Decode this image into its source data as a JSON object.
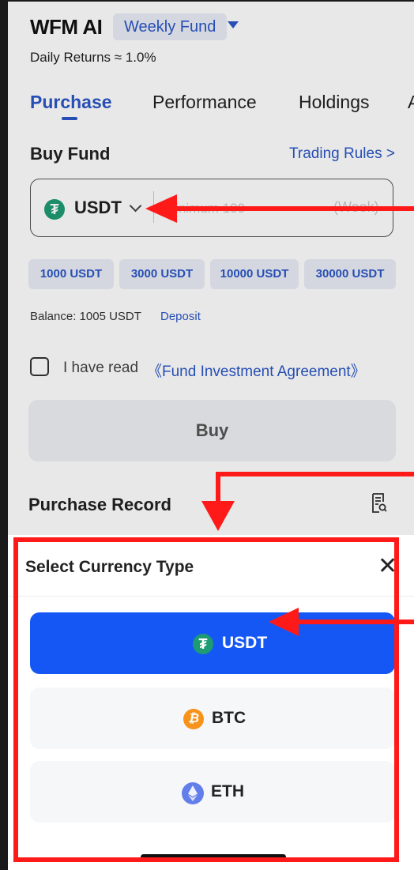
{
  "header": {
    "app_title": "WFM AI",
    "fund_selector": "Weekly Fund",
    "daily_returns": "Daily Returns ≈ 1.0%"
  },
  "tabs": [
    {
      "label": "Purchase",
      "active": true
    },
    {
      "label": "Performance",
      "active": false
    },
    {
      "label": "Holdings",
      "active": false
    },
    {
      "label": "A",
      "active": false
    }
  ],
  "buy": {
    "section_title": "Buy Fund",
    "trading_rules": "Trading Rules >",
    "currency": "USDT",
    "currency_coin_glyph": "₮",
    "amount_placeholder": "Minimum 100",
    "period_suffix": "(Week)",
    "quick_amounts": [
      "1000 USDT",
      "3000 USDT",
      "10000 USDT",
      "30000 USDT"
    ],
    "balance": "Balance: 1005 USDT",
    "deposit": "Deposit",
    "agreement_prefix": "I have read",
    "agreement_link": "《Fund Investment Agreement》",
    "buy_button": "Buy",
    "agreement_checked": false
  },
  "purchase_record": {
    "title": "Purchase Record",
    "icon": "record-search-icon"
  },
  "currency_sheet": {
    "title": "Select Currency Type",
    "close_glyph": "✕",
    "options": [
      {
        "label": "USDT",
        "glyph": "₮",
        "selected": true
      },
      {
        "label": "BTC",
        "glyph": "₿",
        "selected": false
      },
      {
        "label": "ETH",
        "glyph": "",
        "selected": false
      }
    ]
  },
  "colors": {
    "accent": "#2a56c6",
    "selected_option": "#1557f5",
    "annotation_red": "#ff1a1a",
    "usdt_green": "#1e9b73",
    "btc_orange": "#f7931a",
    "eth_blue": "#627eea"
  }
}
